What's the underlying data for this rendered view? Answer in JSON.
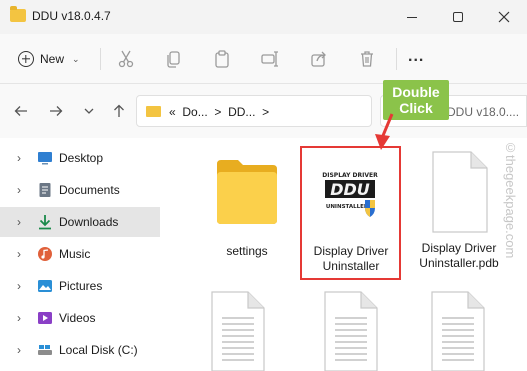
{
  "window": {
    "title": "DDU v18.0.4.7"
  },
  "toolbar": {
    "new_label": "New",
    "more_label": "..."
  },
  "address": {
    "prefix": "«",
    "segment1": "Do...",
    "segment2": "DD...",
    "separator": ">"
  },
  "search": {
    "placeholder": "h DDU v18.0...."
  },
  "sidebar": {
    "items": [
      {
        "label": "Desktop",
        "icon": "desktop-icon",
        "color": "#2f7fd1"
      },
      {
        "label": "Documents",
        "icon": "documents-icon",
        "color": "#6b7785"
      },
      {
        "label": "Downloads",
        "icon": "downloads-icon",
        "color": "#1a8a4a"
      },
      {
        "label": "Music",
        "icon": "music-icon",
        "color": "#e0603a"
      },
      {
        "label": "Pictures",
        "icon": "pictures-icon",
        "color": "#2a8fd6"
      },
      {
        "label": "Videos",
        "icon": "videos-icon",
        "color": "#8a3fc6"
      },
      {
        "label": "Local Disk (C:)",
        "icon": "local-disk-icon",
        "color": "#555555"
      }
    ]
  },
  "files": [
    {
      "label": "settings",
      "type": "folder"
    },
    {
      "label": "Display Driver Uninstaller",
      "type": "application"
    },
    {
      "label": "Display Driver Uninstaller.pdb",
      "type": "document"
    }
  ],
  "app_logo": {
    "top_text": "DISPLAY DRIVER",
    "main_text": "DDU",
    "bottom_text": "UNINSTALLER"
  },
  "annotation": {
    "text": "Double Click",
    "color": "#8bc34a",
    "highlight_color": "#e53935"
  },
  "watermark": {
    "text": "©thegeekpage.com"
  }
}
